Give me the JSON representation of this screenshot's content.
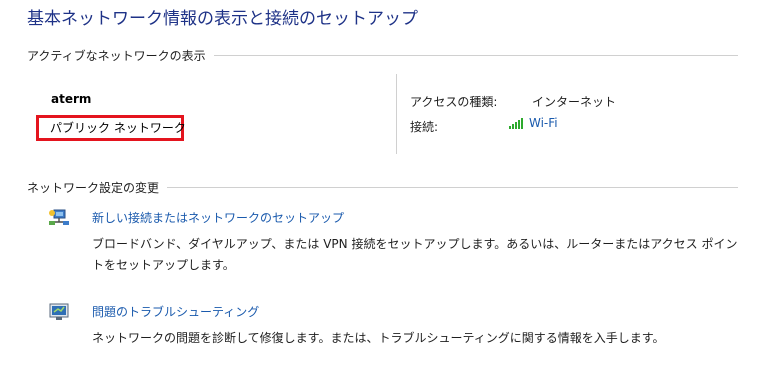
{
  "header": {
    "title": "基本ネットワーク情報の表示と接続のセットアップ"
  },
  "active_networks": {
    "section_label": "アクティブなネットワークの表示",
    "network_name": "aterm",
    "network_type": "パブリック ネットワーク",
    "access_type_label": "アクセスの種類:",
    "access_type_value": "インターネット",
    "connection_label": "接続:",
    "connection_value": "Wi-Fi",
    "connection_icon": "wifi-signal-icon",
    "signal_color": "#2eaa2e"
  },
  "change_settings": {
    "section_label": "ネットワーク設定の変更",
    "tasks": [
      {
        "icon": "network-setup-icon",
        "link": "新しい接続またはネットワークのセットアップ",
        "description": "ブロードバンド、ダイヤルアップ、または VPN 接続をセットアップします。あるいは、ルーターまたはアクセス ポイントをセットアップします。"
      },
      {
        "icon": "troubleshoot-icon",
        "link": "問題のトラブルシューティング",
        "description": "ネットワークの問題を診断して修復します。または、トラブルシューティングに関する情報を入手します。"
      }
    ]
  },
  "colors": {
    "title": "#1e3287",
    "link": "#1a5aad",
    "highlight_box": "#e4141e"
  }
}
